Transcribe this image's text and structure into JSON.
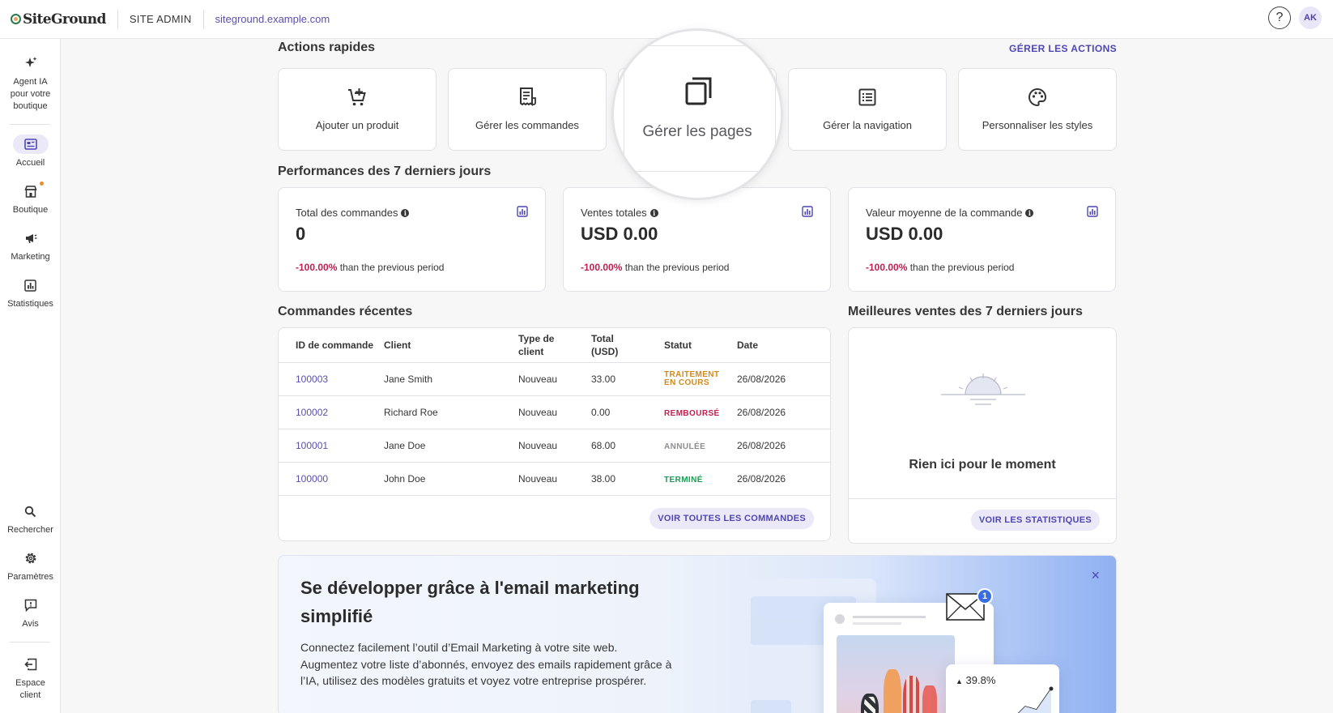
{
  "topbar": {
    "logo_text": "SiteGround",
    "site_admin": "SITE ADMIN",
    "site_url": "siteground.example.com",
    "help": "?",
    "avatar": "AK"
  },
  "sidebar": {
    "ai_agent": "Agent IA pour votre boutique",
    "items": [
      {
        "label": "Accueil",
        "icon": "home-dashboard-icon"
      },
      {
        "label": "Boutique",
        "icon": "store-icon"
      },
      {
        "label": "Marketing",
        "icon": "megaphone-icon"
      },
      {
        "label": "Statistiques",
        "icon": "bar-chart-icon"
      }
    ],
    "bottom": [
      {
        "label": "Rechercher",
        "icon": "search-icon"
      },
      {
        "label": "Paramètres",
        "icon": "gear-icon"
      },
      {
        "label": "Avis",
        "icon": "feedback-icon"
      },
      {
        "label": "Espace client",
        "icon": "exit-icon"
      }
    ]
  },
  "quick_actions": {
    "title": "Actions rapides",
    "manage_link": "GÉRER LES ACTIONS",
    "items": [
      {
        "label": "Ajouter un produit",
        "icon": "cart-add-icon"
      },
      {
        "label": "Gérer les commandes",
        "icon": "receipt-icon"
      },
      {
        "label": "Gérer les pages",
        "icon": "pages-icon"
      },
      {
        "label": "Gérer la navigation",
        "icon": "list-icon"
      },
      {
        "label": "Personnaliser les styles",
        "icon": "palette-icon"
      }
    ]
  },
  "performance": {
    "title": "Performances des 7 derniers jours",
    "cards": [
      {
        "title": "Total des commandes",
        "value": "0",
        "change": "-100.00%",
        "change_text": "than the previous period"
      },
      {
        "title": "Ventes totales",
        "value": "USD 0.00",
        "change": "-100.00%",
        "change_text": "than the previous period"
      },
      {
        "title": "Valeur moyenne de la commande",
        "value": "USD 0.00",
        "change": "-100.00%",
        "change_text": "than the previous period"
      }
    ]
  },
  "orders": {
    "title": "Commandes récentes",
    "headers": [
      "ID de commande",
      "Client",
      "Type de client",
      "Total (USD)",
      "Statut",
      "Date"
    ],
    "rows": [
      {
        "id": "100003",
        "client": "Jane Smith",
        "type": "Nouveau",
        "total": "33.00",
        "status": "TRAITEMENT EN COURS",
        "date": "26/08/2026"
      },
      {
        "id": "100002",
        "client": "Richard Roe",
        "type": "Nouveau",
        "total": "0.00",
        "status": "REMBOURSÉ",
        "date": "26/08/2026"
      },
      {
        "id": "100001",
        "client": "Jane Doe",
        "type": "Nouveau",
        "total": "68.00",
        "status": "ANNULÉE",
        "date": "26/08/2026"
      },
      {
        "id": "100000",
        "client": "John Doe",
        "type": "Nouveau",
        "total": "38.00",
        "status": "TERMINÉ",
        "date": "26/08/2026"
      }
    ],
    "view_all": "VOIR TOUTES LES COMMANDES"
  },
  "best_sellers": {
    "title": "Meilleures ventes des 7 derniers jours",
    "empty": "Rien ici pour le moment",
    "view_stats": "VOIR LES STATISTIQUES"
  },
  "promo": {
    "title": "Se développer grâce à l'email marketing simplifié",
    "body": "Connectez facilement l’outil d’Email Marketing à votre site web. Augmentez votre liste d’abonnés, envoyez des emails rapidement grâce à l’IA, utilisez des modèles gratuits et voyez votre entreprise prospérer.",
    "close": "×",
    "badge": "1",
    "stat": "39.8%"
  },
  "colors": {
    "accent": "#4f46b5",
    "negative": "#c0204f",
    "processing": "#d08a1c",
    "done": "#1f9a57"
  }
}
